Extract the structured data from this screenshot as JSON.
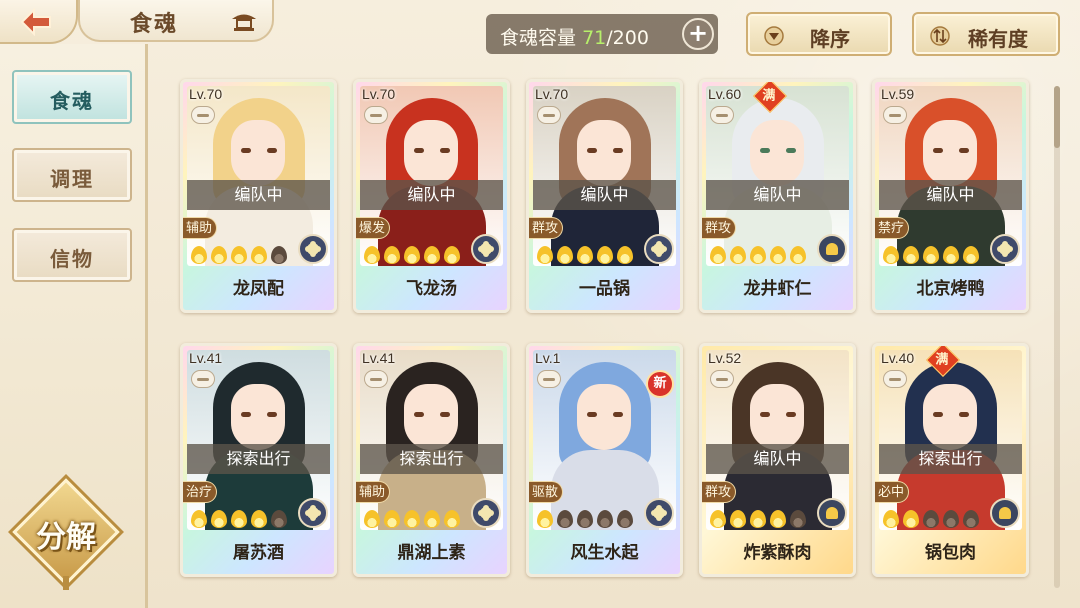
{
  "header": {
    "title": "食魂",
    "capacity_label": "食魂容量",
    "capacity_current": "71",
    "capacity_total": "/200",
    "sort_order_label": "降序",
    "sort_field_label": "稀有度"
  },
  "sidebar": {
    "tabs": [
      {
        "label": "食魂",
        "active": true
      },
      {
        "label": "调理",
        "active": false
      },
      {
        "label": "信物",
        "active": false
      }
    ],
    "decompose_label": "分解"
  },
  "badges": {
    "full": "满",
    "new": "新"
  },
  "colors": {
    "capacity_current": "#b7f06a",
    "active_tab": "#bfe2de"
  },
  "cards": [
    {
      "level": "Lv.70",
      "status": "编队中",
      "role": "辅助",
      "name": "龙凤配",
      "flames_on": 4,
      "flames_total": 5,
      "frame": "rainbow",
      "element": "dark",
      "full": false,
      "new": false
    },
    {
      "level": "Lv.70",
      "status": "编队中",
      "role": "爆发",
      "name": "飞龙汤",
      "flames_on": 5,
      "flames_total": 5,
      "frame": "rainbow",
      "element": "dark",
      "full": false,
      "new": false
    },
    {
      "level": "Lv.70",
      "status": "编队中",
      "role": "群攻",
      "name": "一品锅",
      "flames_on": 5,
      "flames_total": 5,
      "frame": "rainbow",
      "element": "dark",
      "full": false,
      "new": false
    },
    {
      "level": "Lv.60",
      "status": "编队中",
      "role": "群攻",
      "name": "龙井虾仁",
      "flames_on": 5,
      "flames_total": 5,
      "frame": "rainbow",
      "element": "gold",
      "full": true,
      "new": false
    },
    {
      "level": "Lv.59",
      "status": "编队中",
      "role": "禁疗",
      "name": "北京烤鸭",
      "flames_on": 5,
      "flames_total": 5,
      "frame": "rainbow",
      "element": "dark",
      "full": false,
      "new": false
    },
    {
      "level": "Lv.41",
      "status": "探索出行",
      "role": "治疗",
      "name": "屠苏酒",
      "flames_on": 4,
      "flames_total": 5,
      "frame": "rainbow",
      "element": "dark",
      "full": false,
      "new": false
    },
    {
      "level": "Lv.41",
      "status": "探索出行",
      "role": "辅助",
      "name": "鼎湖上素",
      "flames_on": 5,
      "flames_total": 5,
      "frame": "rainbow",
      "element": "dark",
      "full": false,
      "new": false
    },
    {
      "level": "Lv.1",
      "status": "",
      "role": "驱散",
      "name": "风生水起",
      "flames_on": 1,
      "flames_total": 5,
      "frame": "rainbow",
      "element": "dark",
      "full": false,
      "new": true
    },
    {
      "level": "Lv.52",
      "status": "编队中",
      "role": "群攻",
      "name": "炸紫酥肉",
      "flames_on": 4,
      "flames_total": 5,
      "frame": "gold",
      "element": "gold",
      "full": false,
      "new": false
    },
    {
      "level": "Lv.40",
      "status": "探索出行",
      "role": "必中",
      "name": "锅包肉",
      "flames_on": 2,
      "flames_total": 5,
      "frame": "gold",
      "element": "gold",
      "full": true,
      "new": false
    }
  ]
}
